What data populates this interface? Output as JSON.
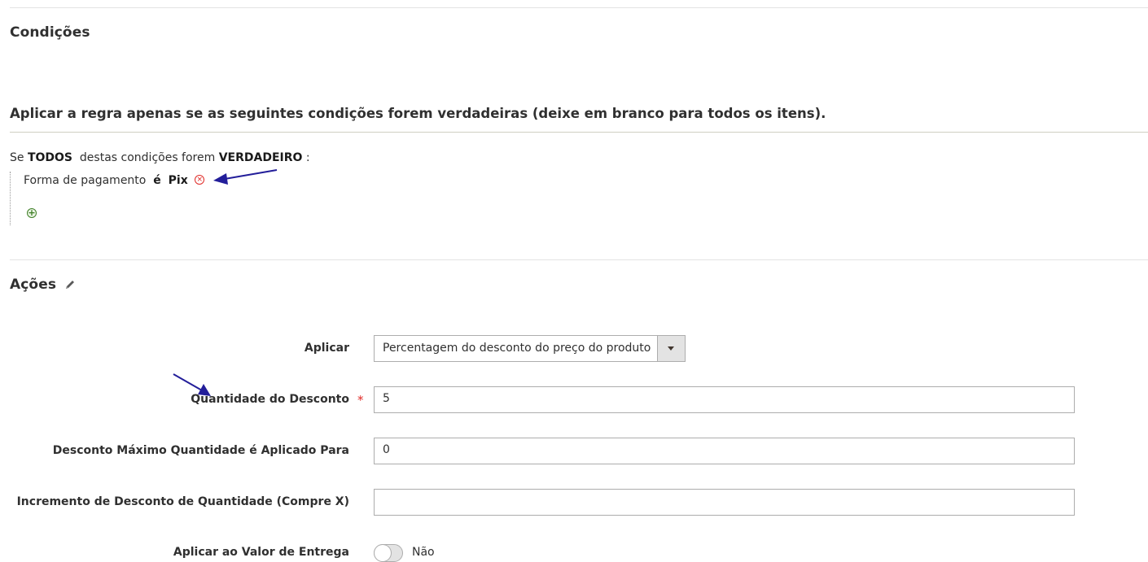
{
  "conditions": {
    "title": "Condições",
    "instructions": "Aplicar a regra apenas se as seguintes condições forem verdadeiras (deixe em branco para todos os itens).",
    "rule": {
      "prefix": "Se",
      "aggregator": "TODOS",
      "middle": "destas condições forem",
      "value": "VERDADEIRO",
      "suffix": ":"
    },
    "condition_row": {
      "attribute": "Forma de pagamento",
      "operator": "é",
      "value": "Pix",
      "remove_icon": "remove-circle-icon"
    },
    "add_icon": "add-circle-icon"
  },
  "actions": {
    "title": "Ações",
    "edit_icon": "pencil-icon",
    "fields": {
      "apply": {
        "label": "Aplicar",
        "value": "Percentagem do desconto do preço do produto"
      },
      "discount_amount": {
        "label": "Quantidade do Desconto",
        "required_mark": "*",
        "value": "5"
      },
      "max_qty": {
        "label": "Desconto Máximo Quantidade é Aplicado Para",
        "value": "0"
      },
      "discount_step": {
        "label": "Incremento de Desconto de Quantidade (Compre X)",
        "value": ""
      },
      "apply_to_shipping": {
        "label": "Aplicar ao Valor de Entrega",
        "state_label": "Não",
        "checked": false
      }
    }
  },
  "colors": {
    "annotation_arrow": "#231e9a",
    "required": "#e02b27",
    "add": "#3f7f27"
  }
}
